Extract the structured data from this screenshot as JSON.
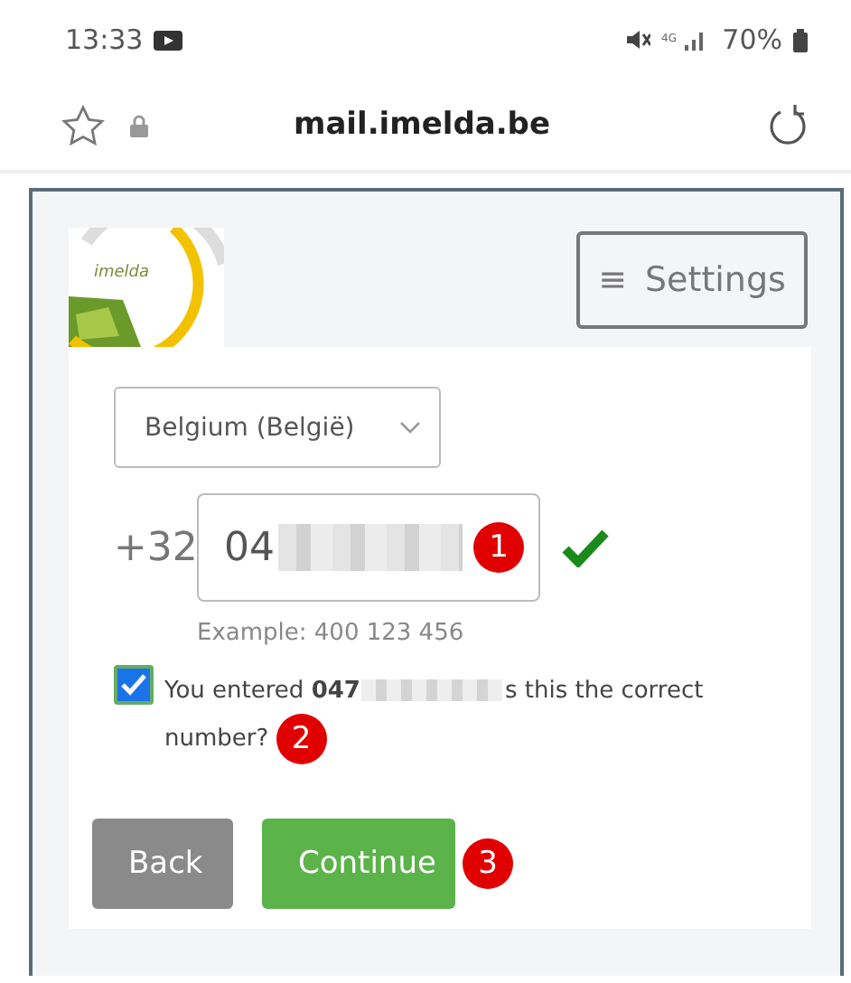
{
  "status_bar": {
    "time": "13:33",
    "network": "4G",
    "battery": "70%"
  },
  "browser": {
    "url": "mail.imelda.be"
  },
  "header": {
    "logo_text": "imelda",
    "settings_button": "Settings",
    "menu_glyph": "≡"
  },
  "form": {
    "country": "Belgium (België)",
    "prefix": "+32",
    "phone_value": "04",
    "phone_valid": true,
    "example": "Example: 400 123 456",
    "confirm_checked": true,
    "confirm_before": "You entered **047**",
    "confirm_after": "s this the correct number?",
    "buttons": [
      {
        "label": "Back",
        "kind": "secondary"
      },
      {
        "label": "Continue",
        "kind": "primary"
      }
    ]
  },
  "annotations": [
    "1",
    "2",
    "3"
  ]
}
